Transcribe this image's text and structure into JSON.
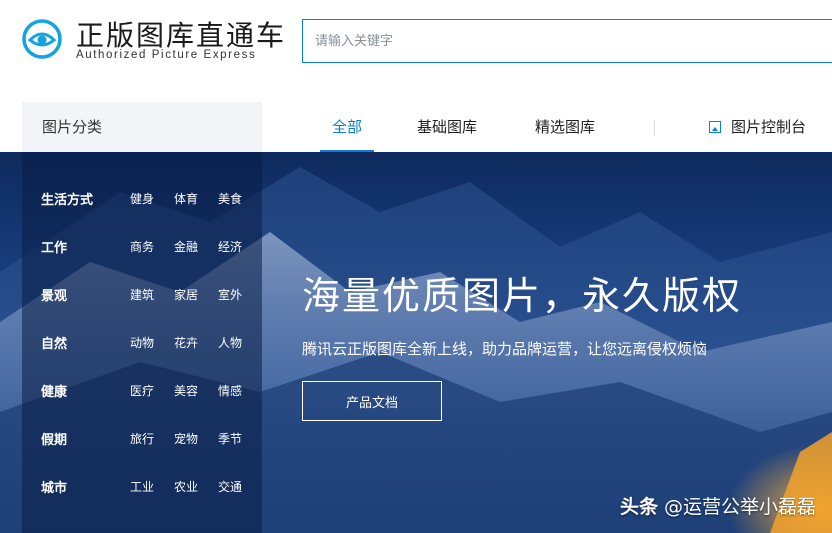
{
  "brand": {
    "name_cn": "正版图库直通车",
    "name_en": "Authorized Picture Express",
    "logo_icon": "eye-logo-icon"
  },
  "search": {
    "placeholder": "请输入关键字",
    "value": ""
  },
  "category_header": "图片分类",
  "nav": {
    "tabs": [
      {
        "label": "全部",
        "active": true
      },
      {
        "label": "基础图库",
        "active": false
      },
      {
        "label": "精选图库",
        "active": false
      }
    ],
    "console": {
      "label": "图片控制台",
      "icon": "image-icon"
    }
  },
  "categories": [
    {
      "name": "生活方式",
      "subs": [
        "健身",
        "体育",
        "美食"
      ]
    },
    {
      "name": "工作",
      "subs": [
        "商务",
        "金融",
        "经济"
      ]
    },
    {
      "name": "景观",
      "subs": [
        "建筑",
        "家居",
        "室外"
      ]
    },
    {
      "name": "自然",
      "subs": [
        "动物",
        "花卉",
        "人物"
      ]
    },
    {
      "name": "健康",
      "subs": [
        "医疗",
        "美容",
        "情感"
      ]
    },
    {
      "name": "假期",
      "subs": [
        "旅行",
        "宠物",
        "季节"
      ]
    },
    {
      "name": "城市",
      "subs": [
        "工业",
        "农业",
        "交通"
      ]
    }
  ],
  "hero": {
    "title": "海量优质图片，永久版权",
    "subtitle": "腾讯云正版图库全新上线，助力品牌运营，让您远离侵权烦恼",
    "button": "产品文档"
  },
  "watermark": {
    "prefix": "头条",
    "handle": "@运营公举小磊磊"
  },
  "colors": {
    "accent": "#0d7fd4",
    "hero_bg": "#1a3f80",
    "panel_bg": "#f2f4f7"
  }
}
